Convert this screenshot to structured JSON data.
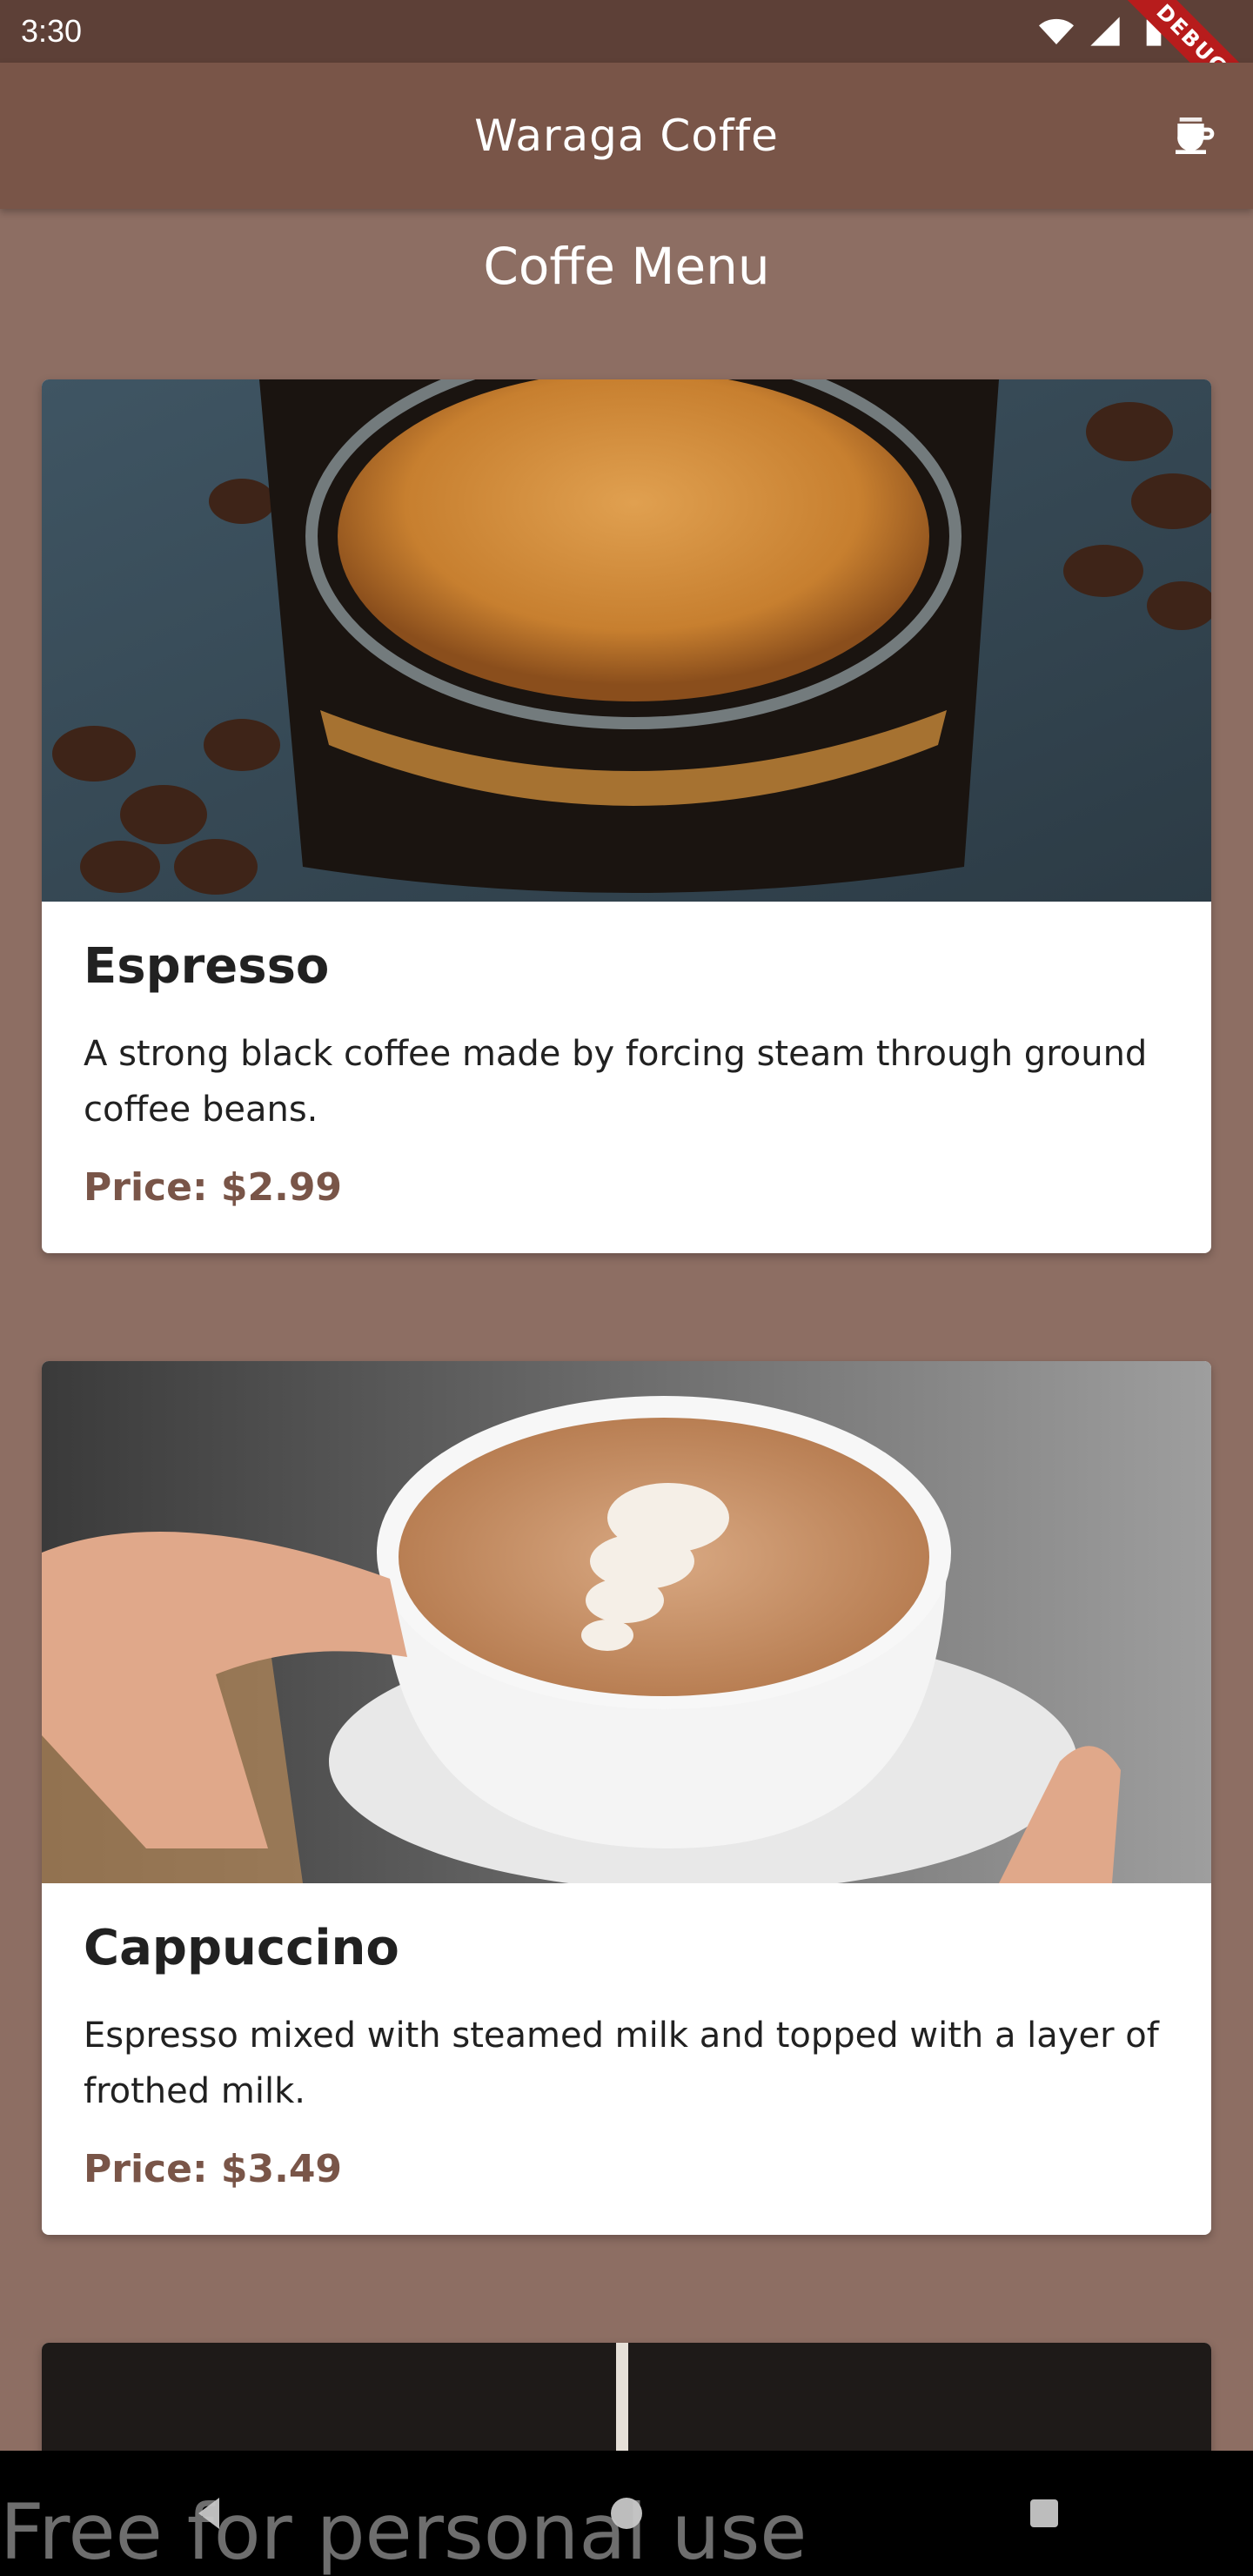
{
  "status_bar": {
    "time": "3:30",
    "icons": [
      "wifi-icon",
      "signal-icon",
      "battery-icon"
    ],
    "debug_label": "DEBUG"
  },
  "app_bar": {
    "title": "Waraga Coffe",
    "action_icon": "coffee-cup-icon"
  },
  "section_title": "Coffe Menu",
  "menu": [
    {
      "name": "Espresso",
      "description": "A strong black coffee made by forcing steam through ground coffee beans.",
      "price": "Price: $2.99",
      "image": "espresso-photo"
    },
    {
      "name": "Cappuccino",
      "description": "Espresso mixed with steamed milk and topped with a layer of frothed milk.",
      "price": "Price: $3.49",
      "image": "cappuccino-photo"
    }
  ],
  "nav_bar": {
    "buttons": [
      "back-icon",
      "home-icon",
      "recents-icon"
    ]
  },
  "watermark": "Free for personal use",
  "colors": {
    "background": "#8d6e63",
    "app_bar": "#795548",
    "status_bar": "#5d4037",
    "price_text": "#795548"
  }
}
